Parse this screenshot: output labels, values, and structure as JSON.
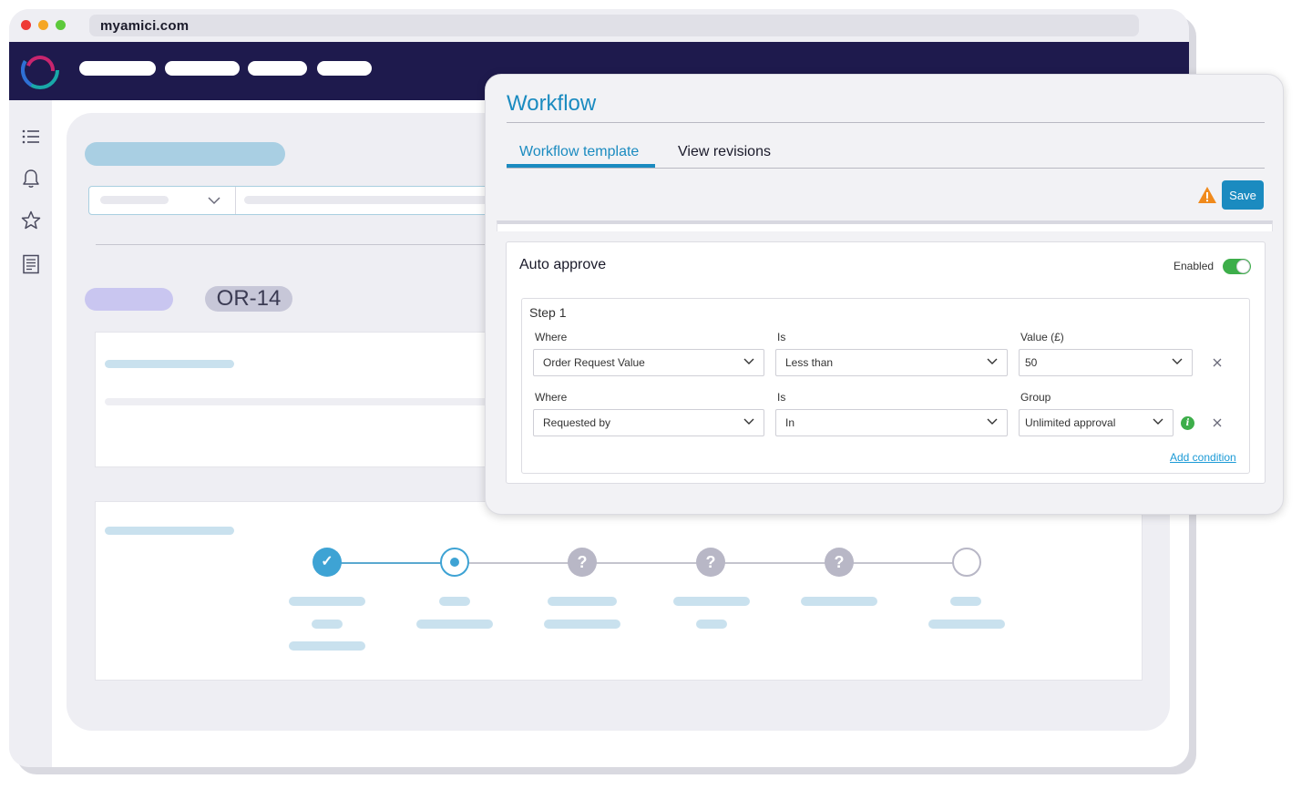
{
  "browser": {
    "url": "myamici.com"
  },
  "background": {
    "order_badge": "OR-14"
  },
  "progress": {
    "steps": [
      {
        "state": "done",
        "glyph": "✓"
      },
      {
        "state": "current",
        "glyph": ""
      },
      {
        "state": "unknown",
        "glyph": "?"
      },
      {
        "state": "unknown",
        "glyph": "?"
      },
      {
        "state": "unknown",
        "glyph": "?"
      },
      {
        "state": "pending",
        "glyph": ""
      }
    ]
  },
  "modal": {
    "title": "Workflow",
    "tabs": [
      {
        "label": "Workflow template",
        "active": true
      },
      {
        "label": "View revisions",
        "active": false
      }
    ],
    "save_label": "Save",
    "auto_approve": {
      "title": "Auto approve",
      "enabled_label": "Enabled",
      "enabled": true,
      "step": {
        "title": "Step 1",
        "conditions": [
          {
            "field_label": "Where",
            "field_value": "Order Request Value",
            "op_label": "Is",
            "op_value": "Less than",
            "value_label": "Value (£)",
            "value_value": "50"
          },
          {
            "field_label": "Where",
            "field_value": "Requested by",
            "op_label": "Is",
            "op_value": "In",
            "value_label": "Group",
            "value_value": "Unlimited approval"
          }
        ],
        "add_condition_label": "Add condition"
      }
    }
  },
  "colors": {
    "brand_navy": "#1e1a4d",
    "accent_blue": "#1b8bc0",
    "success_green": "#3dae4a",
    "warning_orange": "#f08a1c"
  }
}
